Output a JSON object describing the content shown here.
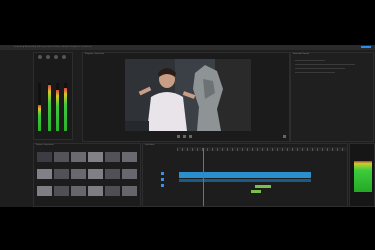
{
  "app": {
    "menu_tabs": "Learning   Assembly   Editing   Color   Effects   Audio   Graphics   Libraries"
  },
  "meters": {
    "levels": [
      0.55,
      0.95,
      0.85,
      0.9,
      0.75
    ],
    "labels": [
      "S",
      "S",
      "S",
      "S"
    ]
  },
  "monitor": {
    "title": "Program: Interview",
    "colors": {
      "video_bg": "#3a3a3a",
      "accent": "#2d8ceb"
    }
  },
  "right_panel": {
    "title": "Essential Sound"
  },
  "bin": {
    "title": "Project: Interview",
    "thumb_count": 18
  },
  "timeline": {
    "title": "Interview",
    "timecode": "00:00:00:00"
  },
  "right_meter": {
    "level": 0.62
  }
}
